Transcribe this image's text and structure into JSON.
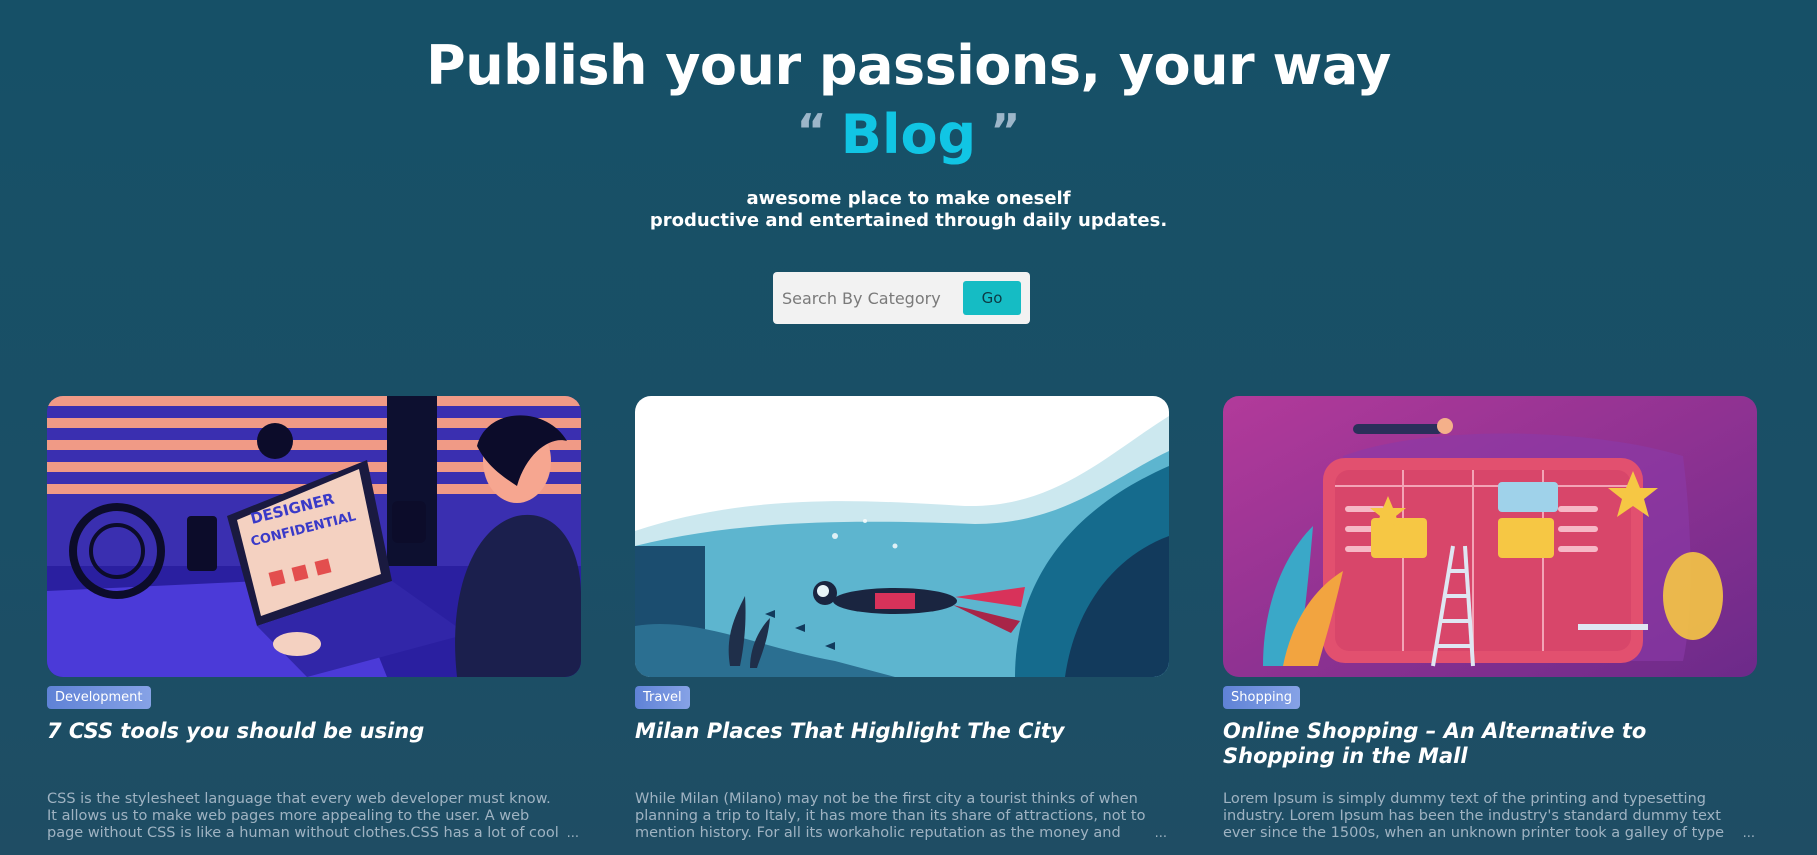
{
  "hero": {
    "title": "Publish your passions, your way",
    "open_quote": "“",
    "blog_word": "Blog",
    "close_quote": "”",
    "subtitle_line1": "awesome place to make oneself",
    "subtitle_line2": "productive and entertained through daily updates."
  },
  "search": {
    "placeholder": "Search By Category",
    "value": "",
    "go_label": "Go"
  },
  "cards": [
    {
      "category": "Development",
      "title": "7 CSS tools you should be using",
      "excerpt": "CSS is the stylesheet language that every web developer must know. It allows us to make web pages more appealing to the user. A web page without CSS is like a human without clothes.CSS has a lot of cool",
      "more": "..."
    },
    {
      "category": "Travel",
      "title": "Milan Places That Highlight The City",
      "excerpt": "While Milan (Milano) may not be the first city a tourist thinks of when planning a trip to Italy, it has more than its share of attractions, not to mention history. For all its workaholic reputation as the money and",
      "more": "..."
    },
    {
      "category": "Shopping",
      "title": "Online Shopping – An Alternative to Shopping in the Mall",
      "excerpt": "Lorem Ipsum is simply dummy text of the printing and typesetting industry. Lorem Ipsum has been the industry's standard dummy text ever since the 1500s, when an unknown printer took a galley of type and",
      "more": "..."
    }
  ],
  "colors": {
    "background": "#165067",
    "accent": "#11c5e4",
    "button": "#15bcc4",
    "badge": "#6f8fdc"
  }
}
